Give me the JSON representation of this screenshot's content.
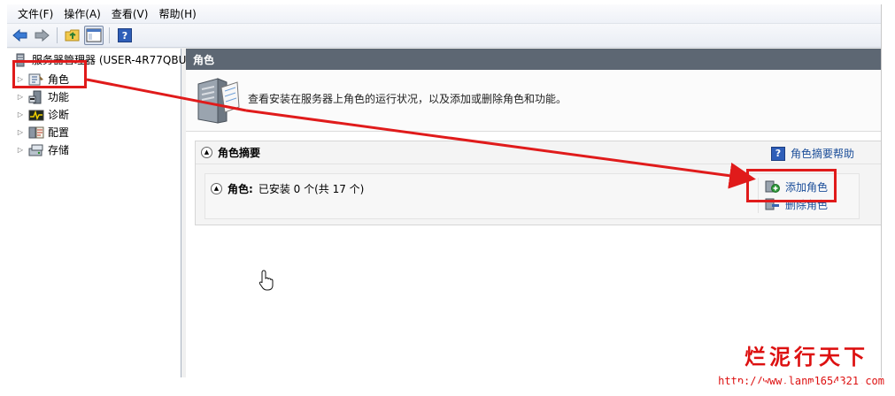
{
  "menubar": {
    "items": [
      "文件(F)",
      "操作(A)",
      "查看(V)",
      "帮助(H)"
    ]
  },
  "toolbar": {
    "buttons": [
      "back-icon",
      "forward-icon",
      "up-folder-icon",
      "show-hide-tree-icon",
      "help-icon"
    ]
  },
  "tree": {
    "root": "服务器管理器 (USER-4R77QBU",
    "items": [
      {
        "label": "角色",
        "icon": "roles-icon"
      },
      {
        "label": "功能",
        "icon": "features-icon"
      },
      {
        "label": "诊断",
        "icon": "diagnostics-icon"
      },
      {
        "label": "配置",
        "icon": "configuration-icon"
      },
      {
        "label": "存储",
        "icon": "storage-icon"
      }
    ]
  },
  "main": {
    "header": "角色",
    "intro": "查看安装在服务器上角色的运行状况，以及添加或删除角色和功能。",
    "summary": {
      "title": "角色摘要",
      "help": "角色摘要帮助",
      "roles_label": "角色:",
      "roles_status": "已安装 0 个(共 17 个)",
      "actions": [
        "添加角色",
        "删除角色"
      ]
    }
  },
  "watermark": {
    "text": "烂泥行天下",
    "url": "http://www.lanm1654321.com"
  },
  "colors": {
    "highlight": "#e01b1b",
    "header_bar": "#5d6773",
    "link": "#1a4d99"
  }
}
